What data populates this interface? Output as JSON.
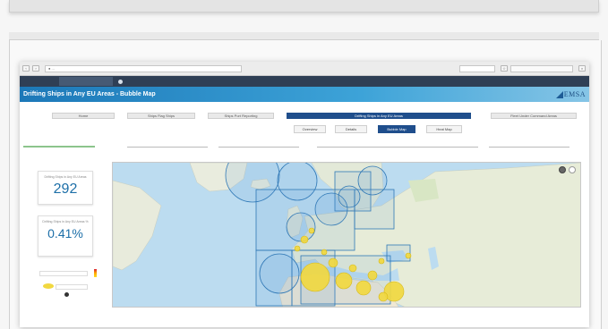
{
  "browser": {
    "url": "● ..."
  },
  "app": {
    "title": "Drifting Ships in Any EU Areas - Bubble Map",
    "logo_text": "EMSA"
  },
  "nav": {
    "items": [
      {
        "label": "Home"
      },
      {
        "label": "Ships Flag Ships"
      },
      {
        "label": "Ships Port Reporting"
      },
      {
        "label": "Drifting Ships in Any EU Areas",
        "active": true
      },
      {
        "label": "Fleet Under Command Areas"
      }
    ],
    "sub_items": [
      {
        "label": "Overview"
      },
      {
        "label": "Details"
      },
      {
        "label": "Bubble Map",
        "active": true
      },
      {
        "label": "Heat Map"
      }
    ]
  },
  "kpis": [
    {
      "label": "Drifting Ships in Any EU Areas",
      "value": "292"
    },
    {
      "label": "Drifting Ships in Any EU Areas %",
      "value": "0.41%"
    }
  ],
  "colors": {
    "accent": "#1f4e8c",
    "title_bar_start": "#1c78b8",
    "kpi_value": "#1d6fa8",
    "bubble": "#f1d840"
  },
  "icons": [
    "eye-icon",
    "expand-icon",
    "info-icon"
  ]
}
